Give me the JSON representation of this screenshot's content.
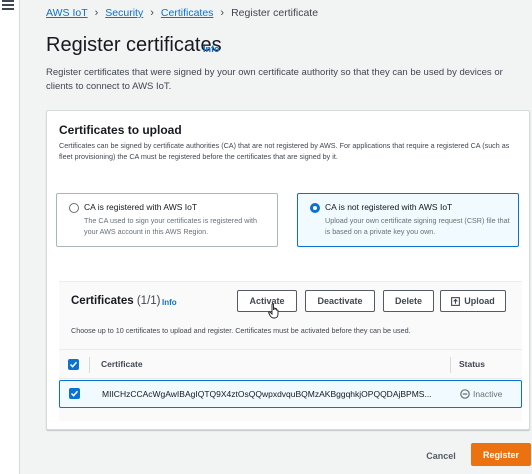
{
  "breadcrumb": {
    "items": [
      "AWS IoT",
      "Security",
      "Certificates"
    ],
    "current": "Register certificate"
  },
  "page": {
    "title": "Register certificates",
    "info": "Info",
    "description": "Register certificates that were signed by your own certificate authority so that they can be used by devices or clients to connect to AWS IoT."
  },
  "upload_section": {
    "title": "Certificates to upload",
    "description": "Certificates can be signed by certificate authorities (CA) that are not registered by AWS. For applications that require a registered CA (such as fleet provisioning) the CA must be registered before the certificates that are signed by it.",
    "options": [
      {
        "label": "CA is registered with AWS IoT",
        "description": "The CA used to sign your certificates is registered with your AWS account in this AWS Region.",
        "selected": false
      },
      {
        "label": "CA is not registered with AWS IoT",
        "description": "Upload your own certificate signing request (CSR) file that is based on a private key you own.",
        "selected": true
      }
    ]
  },
  "certificates": {
    "title": "Certificates",
    "count": "(1/1)",
    "info": "Info",
    "buttons": {
      "activate": "Activate",
      "deactivate": "Deactivate",
      "delete": "Delete",
      "upload": "Upload"
    },
    "hint": "Choose up to 10 certificates to upload and register. Certificates must be activated before they can be used.",
    "columns": [
      "Certificate",
      "Status"
    ],
    "rows": [
      {
        "certificate": "MIICHzCCAcWgAwIBAgIQTQ9X4ztOsQQwpxdvquBQMzAKBggqhkjOPQQDAjBPMS...",
        "status": "Inactive",
        "selected": true
      }
    ]
  },
  "footer": {
    "cancel": "Cancel",
    "register": "Register"
  },
  "colors": {
    "link": "#0972d3",
    "primary_button": "#ec7211",
    "selected_bg": "#f1faff"
  },
  "icons": [
    "menu-icon",
    "upload-icon",
    "cursor-icon",
    "status-inactive-icon",
    "checkbox-checked-icon"
  ]
}
